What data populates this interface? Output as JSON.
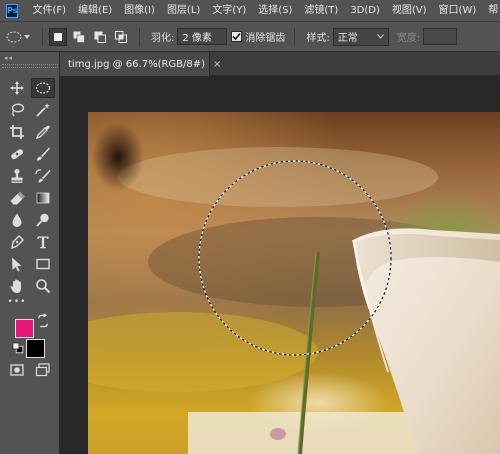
{
  "app": {
    "logo": "Ps"
  },
  "menu": [
    "文件(F)",
    "编辑(E)",
    "图像(I)",
    "图层(L)",
    "文字(Y)",
    "选择(S)",
    "滤镜(T)",
    "3D(D)",
    "视图(V)",
    "窗口(W)",
    "帮"
  ],
  "options": {
    "feather_label": "羽化:",
    "feather_value": "2 像素",
    "antialias_label": "消除锯齿",
    "antialias_checked": true,
    "style_label": "样式:",
    "style_value": "正常",
    "width_label": "宽度:"
  },
  "toolbar": {
    "collapse_glyph": "◂◂",
    "more_glyph": "•••",
    "foreground_color": "#e8167a",
    "background_color": "#000000"
  },
  "document": {
    "tab_title": "timg.jpg @ 66.7%(RGB/8#)",
    "close_glyph": "×"
  },
  "colors": {
    "panel": "#535353",
    "canvas_bg": "#282828",
    "accent": "#31a8ff"
  }
}
